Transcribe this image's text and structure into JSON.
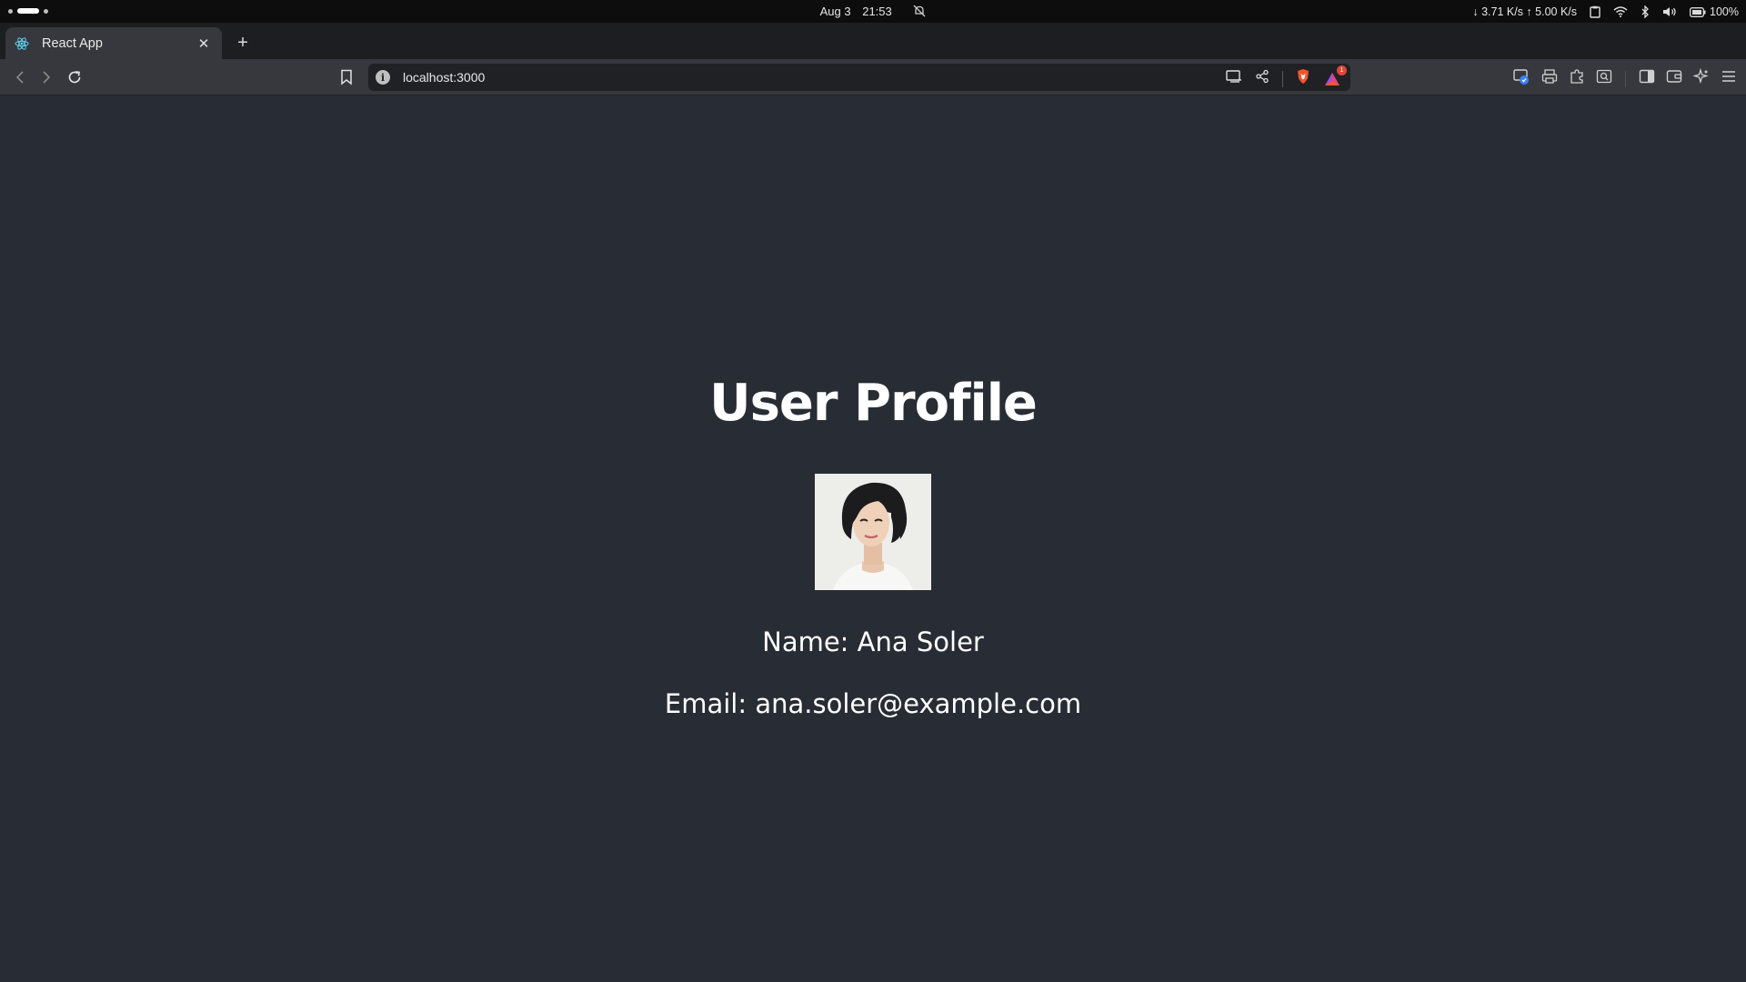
{
  "system_bar": {
    "date": "Aug 3",
    "time": "21:53",
    "net_speed": "↓ 3.71 K/s ↑ 5.00 K/s",
    "battery": "100%"
  },
  "browser": {
    "tab": {
      "title": "React App",
      "close": "✕",
      "icon": "react-logo-icon"
    },
    "new_tab": "+",
    "url": "localhost:3000",
    "rewards_badge": "1",
    "accent": "#fb542b"
  },
  "page": {
    "title": "User Profile",
    "avatar_alt": "portrait photo",
    "name_line": "Name: Ana Soler",
    "email_line": "Email: ana.soler@example.com",
    "background": "#282c34"
  }
}
